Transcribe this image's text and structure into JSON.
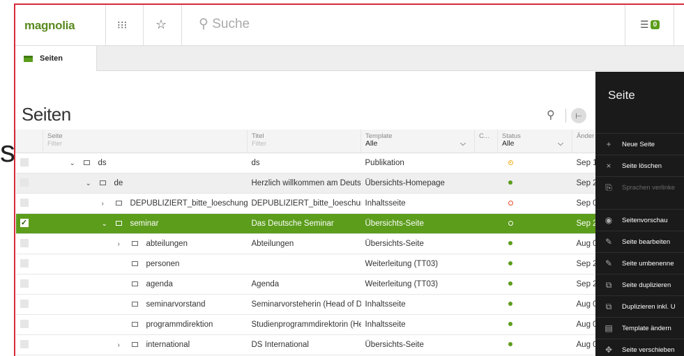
{
  "outer_letter": "s",
  "header": {
    "logo": "magnolia",
    "search_placeholder": "Suche",
    "task_count": "0"
  },
  "tab": {
    "label": "Seiten"
  },
  "page_title": "Seiten",
  "columns": {
    "seite": {
      "label": "Seite",
      "filter": "Filter"
    },
    "titel": {
      "label": "Titel",
      "filter": "Filter"
    },
    "template": {
      "label": "Template",
      "value": "Alle"
    },
    "c": {
      "label": "C..."
    },
    "status": {
      "label": "Status",
      "value": "Alle"
    },
    "aender": {
      "label": "Änder"
    }
  },
  "rows": [
    {
      "name": "ds",
      "title": "ds",
      "template": "Publikation",
      "status": "pending",
      "date": "Sep 1",
      "indent": 0,
      "toggle": "down"
    },
    {
      "name": "de",
      "title": "Herzlich willkommen am Deutsc",
      "template": "Übersichts-Homepage",
      "status": "published",
      "date": "Sep 2",
      "indent": 1,
      "toggle": "down"
    },
    {
      "name": "DEPUBLIZIERT_bitte_loeschung_angeh",
      "title": "DEPUBLIZIERT_bitte_loeschung",
      "template": "Inhaltsseite",
      "status": "unpublished",
      "date": "Sep 0",
      "indent": 2,
      "toggle": "right"
    },
    {
      "name": "seminar",
      "title": "Das Deutsche Seminar",
      "template": "Übersichts-Seite",
      "status": "unpublished",
      "date": "Sep 2",
      "indent": 2,
      "toggle": "down"
    },
    {
      "name": "abteilungen",
      "title": "Abteilungen",
      "template": "Übersichts-Seite",
      "status": "published",
      "date": "Aug 0",
      "indent": 3,
      "toggle": "right"
    },
    {
      "name": "personen",
      "title": "",
      "template": "Weiterleitung (TT03)",
      "status": "published",
      "date": "Sep 2",
      "indent": 3,
      "toggle": ""
    },
    {
      "name": "agenda",
      "title": "Agenda",
      "template": "Weiterleitung (TT03)",
      "status": "published",
      "date": "Sep 2",
      "indent": 3,
      "toggle": ""
    },
    {
      "name": "seminarvorstand",
      "title": "Seminarvorsteherin (Head of De",
      "template": "Inhaltsseite",
      "status": "published",
      "date": "Aug 0",
      "indent": 3,
      "toggle": ""
    },
    {
      "name": "programmdirektion",
      "title": "Studienprogrammdirektorin (He",
      "template": "Inhaltsseite",
      "status": "published",
      "date": "Aug 0",
      "indent": 3,
      "toggle": ""
    },
    {
      "name": "international",
      "title": "DS International",
      "template": "Übersichts-Seite",
      "status": "published",
      "date": "Aug 0",
      "indent": 3,
      "toggle": "right"
    }
  ],
  "panel": {
    "title": "Seite",
    "actions": [
      {
        "label": "Neue Seite",
        "icon": "+",
        "enabled": true
      },
      {
        "label": "Seite löschen",
        "icon": "×",
        "enabled": true
      },
      {
        "label": "Sprachen verlinke",
        "icon": "⎘",
        "enabled": false
      },
      {
        "label": "Seitenvorschau",
        "icon": "◉",
        "enabled": true,
        "group_start": true
      },
      {
        "label": "Seite bearbeiten",
        "icon": "✎",
        "enabled": true
      },
      {
        "label": "Seite umbenenne",
        "icon": "✎",
        "enabled": true
      },
      {
        "label": "Seite duplizieren",
        "icon": "⧉",
        "enabled": true
      },
      {
        "label": "Duplizieren inkl. U",
        "icon": "⧉",
        "enabled": true
      },
      {
        "label": "Template ändern",
        "icon": "▤",
        "enabled": true
      },
      {
        "label": "Seite verschieben",
        "icon": "✥",
        "enabled": true
      }
    ]
  }
}
